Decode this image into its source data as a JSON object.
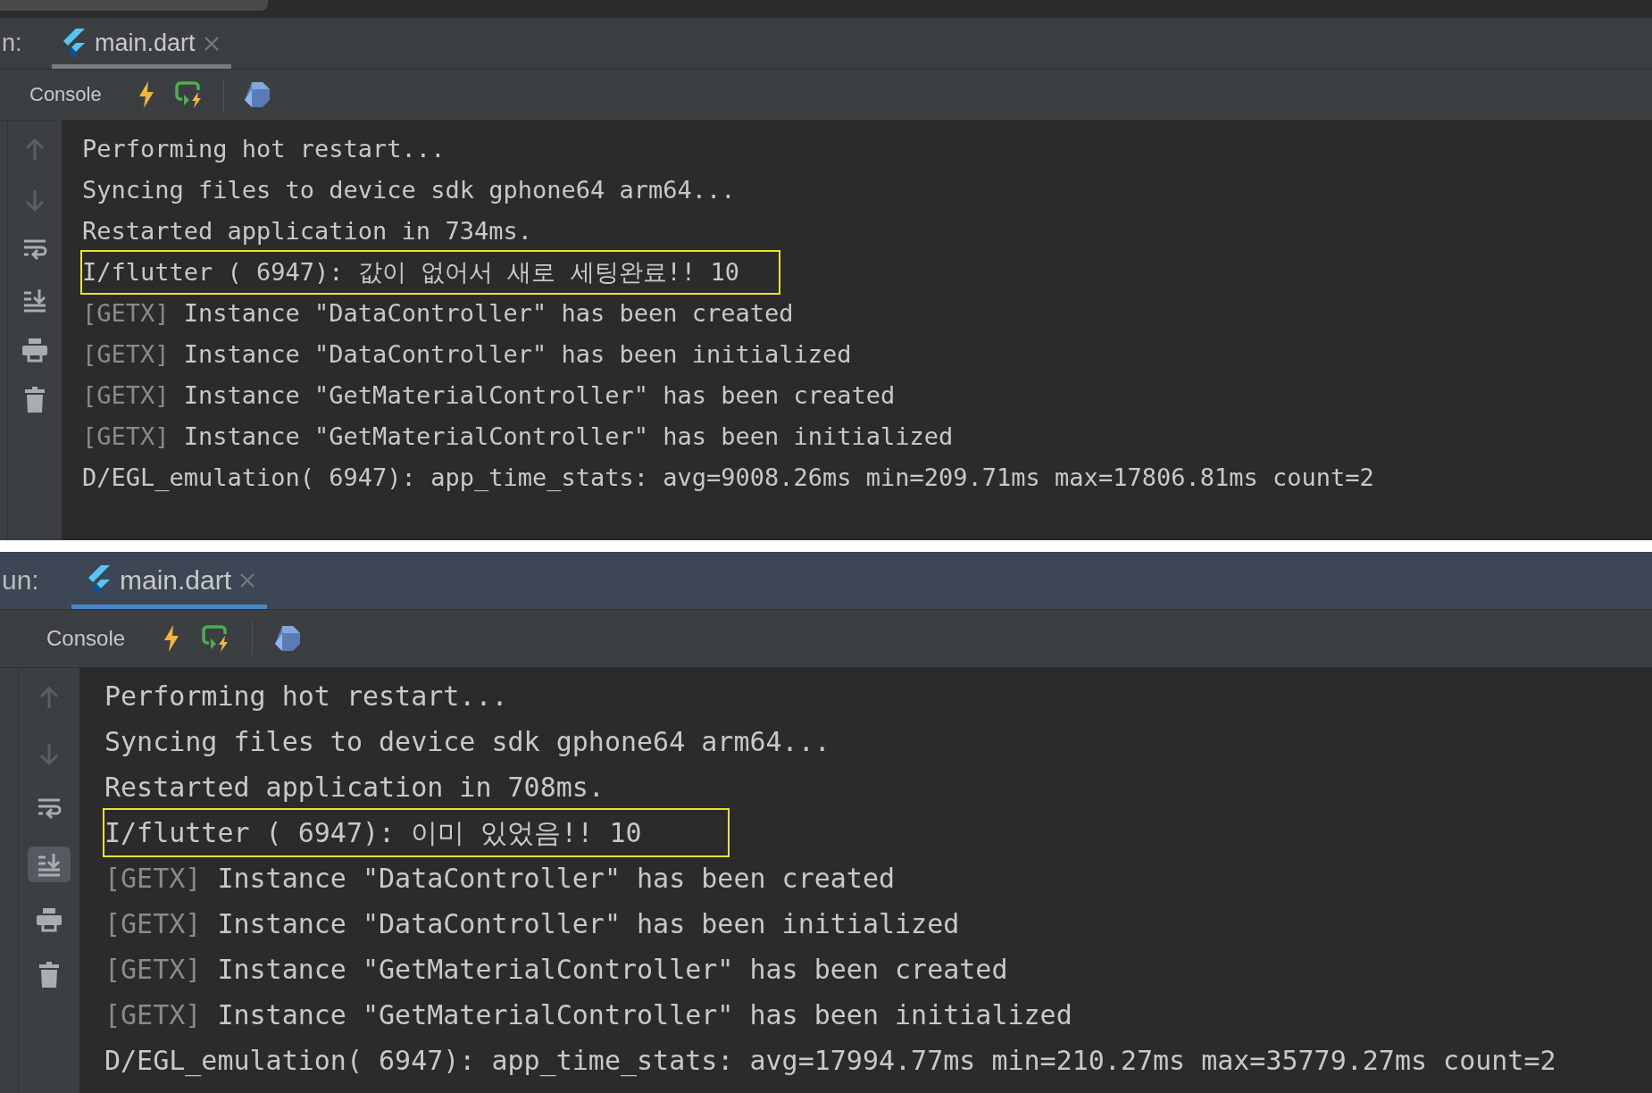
{
  "panels": [
    {
      "focused": false,
      "run_label": "n:",
      "tab": {
        "label": "main.dart",
        "selected": true
      },
      "toolbar": {
        "console_label": "Console"
      },
      "gutter": [
        {
          "kind": "up",
          "disabled": true,
          "selected": false
        },
        {
          "kind": "down",
          "disabled": true,
          "selected": false
        },
        {
          "kind": "wrap",
          "disabled": false,
          "selected": false
        },
        {
          "kind": "scroll_end",
          "disabled": false,
          "selected": false
        },
        {
          "kind": "print",
          "disabled": false,
          "selected": false
        },
        {
          "kind": "clear",
          "disabled": false,
          "selected": false
        }
      ],
      "lines": [
        {
          "text": "Performing hot restart...",
          "highlighted": false
        },
        {
          "text": "Syncing files to device sdk gphone64 arm64...",
          "highlighted": false
        },
        {
          "text": "Restarted application in 734ms.",
          "highlighted": false
        },
        {
          "text": "I/flutter ( 6947): 값이 없어서 새로 세팅완료!! 10",
          "highlighted": true
        },
        {
          "prefix": "[GETX]",
          "text": "Instance \"DataController\" has been created",
          "highlighted": false
        },
        {
          "prefix": "[GETX]",
          "text": "Instance \"DataController\" has been initialized",
          "highlighted": false
        },
        {
          "prefix": "[GETX]",
          "text": "Instance \"GetMaterialController\" has been created",
          "highlighted": false
        },
        {
          "prefix": "[GETX]",
          "text": "Instance \"GetMaterialController\" has been initialized",
          "highlighted": false
        },
        {
          "text": "D/EGL_emulation( 6947): app_time_stats: avg=9008.26ms min=209.71ms max=17806.81ms count=2",
          "highlighted": false
        }
      ]
    },
    {
      "focused": true,
      "run_label": "un:",
      "tab": {
        "label": "main.dart",
        "selected": true
      },
      "toolbar": {
        "console_label": "Console"
      },
      "gutter": [
        {
          "kind": "up",
          "disabled": true,
          "selected": false
        },
        {
          "kind": "down",
          "disabled": true,
          "selected": false
        },
        {
          "kind": "wrap",
          "disabled": false,
          "selected": false
        },
        {
          "kind": "scroll_end",
          "disabled": false,
          "selected": true
        },
        {
          "kind": "print",
          "disabled": false,
          "selected": false
        },
        {
          "kind": "clear",
          "disabled": false,
          "selected": false
        }
      ],
      "lines": [
        {
          "text": "Performing hot restart...",
          "highlighted": false
        },
        {
          "text": "Syncing files to device sdk gphone64 arm64...",
          "highlighted": false
        },
        {
          "text": "Restarted application in 708ms.",
          "highlighted": false
        },
        {
          "text": "I/flutter ( 6947): 이미 있었음!! 10",
          "highlighted": true
        },
        {
          "prefix": "[GETX]",
          "text": "Instance \"DataController\" has been created",
          "highlighted": false
        },
        {
          "prefix": "[GETX]",
          "text": "Instance \"DataController\" has been initialized",
          "highlighted": false
        },
        {
          "prefix": "[GETX]",
          "text": "Instance \"GetMaterialController\" has been created",
          "highlighted": false
        },
        {
          "prefix": "[GETX]",
          "text": "Instance \"GetMaterialController\" has been initialized",
          "highlighted": false
        },
        {
          "text": "D/EGL_emulation( 6947): app_time_stats: avg=17994.77ms min=210.27ms max=35779.27ms count=2",
          "highlighted": false
        }
      ]
    }
  ]
}
